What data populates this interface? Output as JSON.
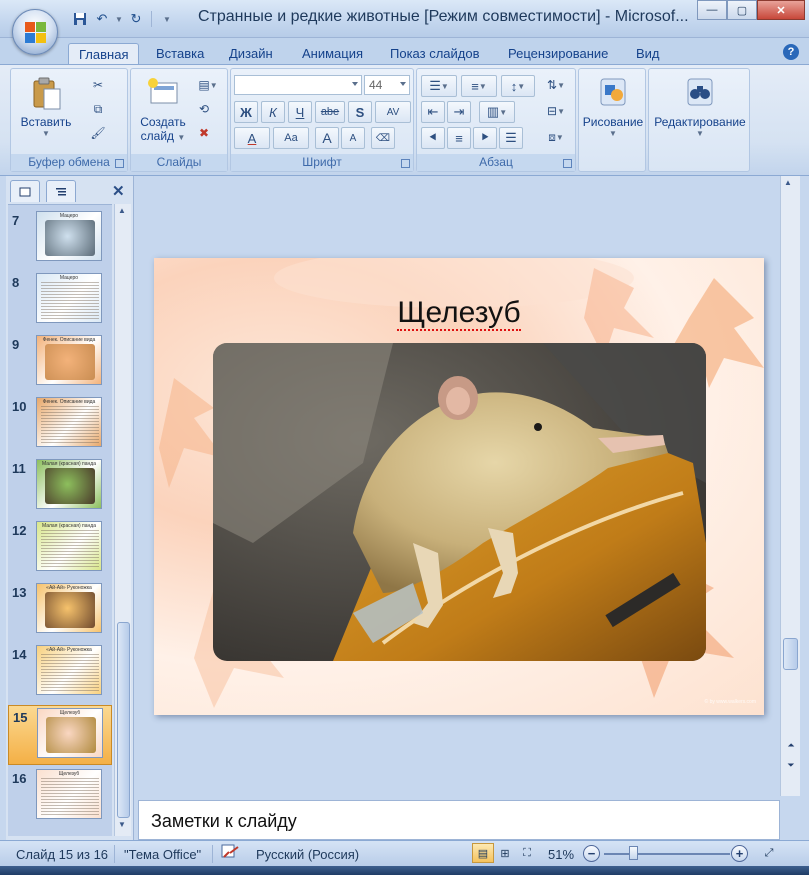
{
  "window": {
    "title": "Странные и редкие животные [Режим совместимости] - Microsof..."
  },
  "tabs": [
    "Главная",
    "Вставка",
    "Дизайн",
    "Анимация",
    "Показ слайдов",
    "Рецензирование",
    "Вид"
  ],
  "ribbon": {
    "clipboard": {
      "label": "Буфер обмена",
      "paste": "Вставить"
    },
    "slides": {
      "label": "Слайды",
      "new_slide_line1": "Создать",
      "new_slide_line2": "слайд"
    },
    "font": {
      "label": "Шрифт",
      "font_name": "",
      "font_size": "44",
      "bold": "Ж",
      "italic": "К",
      "underline": "Ч",
      "strike": "abe",
      "shadow": "S",
      "spacing": "AV",
      "color": "A",
      "case": "Aa",
      "grow": "A",
      "shrink": "A"
    },
    "paragraph": {
      "label": "Абзац"
    },
    "drawing": {
      "label": "Рисование"
    },
    "editing": {
      "label": "Редактирование"
    }
  },
  "pane": {
    "close": "✕"
  },
  "thumbnails": [
    {
      "num": "7",
      "title": "Мацеро",
      "kind": "photo",
      "colors": [
        "#cfe0ee",
        "#5b6b77"
      ]
    },
    {
      "num": "8",
      "title": "Мацеро",
      "kind": "text",
      "colors": [
        "#dbe9f5",
        "#9bbbd9"
      ]
    },
    {
      "num": "9",
      "title": "Фенек. Описание вида",
      "kind": "photo",
      "colors": [
        "#f3b27a",
        "#c98d52"
      ]
    },
    {
      "num": "10",
      "title": "Фенек. Описание вида",
      "kind": "text",
      "colors": [
        "#e8a86a",
        "#c76b3b"
      ]
    },
    {
      "num": "11",
      "title": "Малая (красная) панда",
      "kind": "photo",
      "colors": [
        "#8dbf5d",
        "#4a3a2a"
      ]
    },
    {
      "num": "12",
      "title": "Малая (красная) панда",
      "kind": "text",
      "colors": [
        "#d8e68a",
        "#9bbd3d"
      ]
    },
    {
      "num": "13",
      "title": "«Ай-Ай» Руконожка",
      "kind": "photo",
      "colors": [
        "#f6c26c",
        "#6f4a2e"
      ]
    },
    {
      "num": "14",
      "title": "«Ай-Ай» Руконожка",
      "kind": "text",
      "colors": [
        "#f8d07d",
        "#e8a94f"
      ]
    },
    {
      "num": "15",
      "title": "Щелезуб",
      "kind": "photo",
      "colors": [
        "#fad7c2",
        "#b08a3e"
      ]
    },
    {
      "num": "16",
      "title": "Щелезуб",
      "kind": "text",
      "colors": [
        "#fbe0cf",
        "#f0b599"
      ]
    }
  ],
  "selected_slide": "15",
  "slide": {
    "title": "Щелезуб",
    "watermark": "© by www.walkers.com"
  },
  "notes": {
    "placeholder": "Заметки к слайду"
  },
  "status": {
    "slide_info": "Слайд 15 из 16",
    "theme": "\"Тема Office\"",
    "language": "Русский (Россия)",
    "zoom": "51%",
    "zoom_level": 0.51
  }
}
